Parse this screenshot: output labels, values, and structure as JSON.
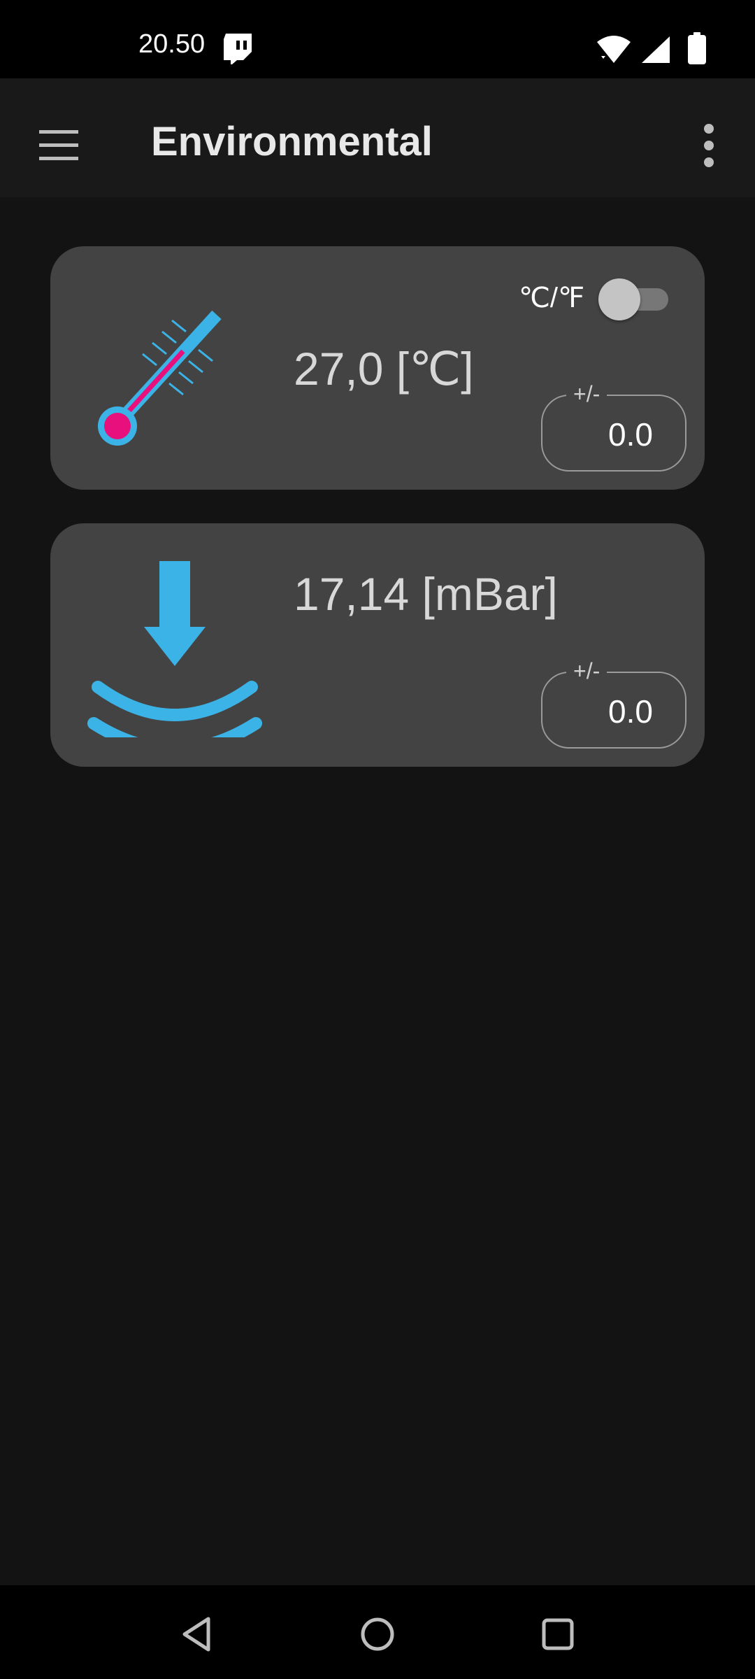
{
  "status_bar": {
    "time": "20.50",
    "app_icon": "twitch-icon",
    "icons": [
      "wifi-icon",
      "signal-icon",
      "battery-icon"
    ]
  },
  "app_bar": {
    "title": "Environmental",
    "menu_icon": "hamburger-menu-icon",
    "overflow_icon": "more-vert-icon"
  },
  "temperature_card": {
    "icon": "thermometer-icon",
    "reading": "27,0 [℃]",
    "unit_toggle_label": "℃/℉",
    "unit_toggle_on": false,
    "offset_label": "+/-",
    "offset_value": "0.0"
  },
  "pressure_card": {
    "icon": "pressure-down-icon",
    "reading": "17,14 [mBar]",
    "offset_label": "+/-",
    "offset_value": "0.0"
  },
  "nav_bar": {
    "buttons": [
      "back-icon",
      "home-icon",
      "recents-icon"
    ]
  },
  "colors": {
    "background": "#131313",
    "card": "#434343",
    "accent_blue": "#3bb3e6",
    "accent_pink": "#e8107c"
  }
}
